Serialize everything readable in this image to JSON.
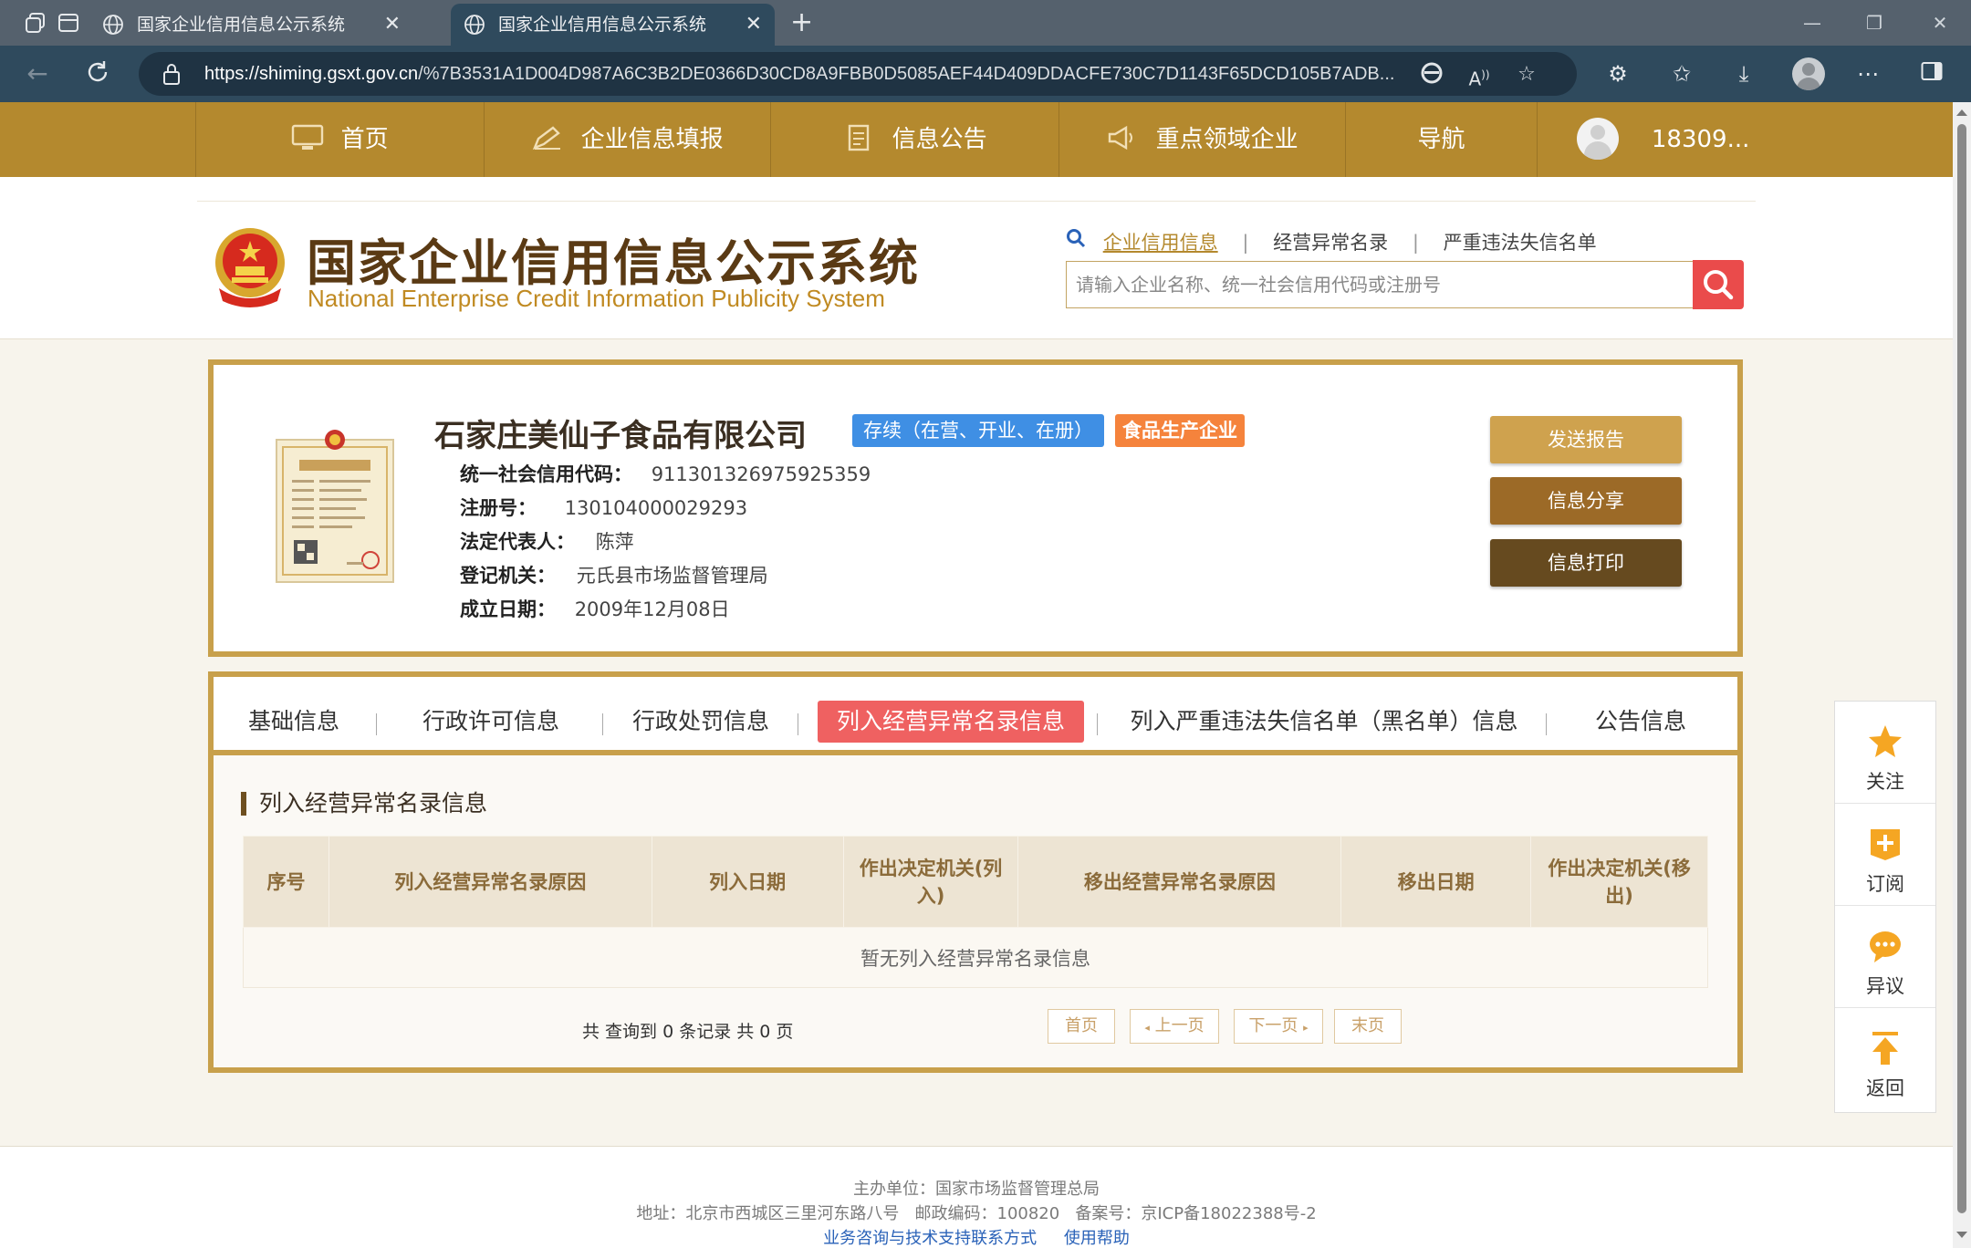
{
  "browser": {
    "tabs": [
      {
        "title": "国家企业信用信息公示系统",
        "active": false
      },
      {
        "title": "国家企业信用信息公示系统",
        "active": true
      }
    ],
    "url_domain": "https://shiming.gsxt.gov.cn",
    "url_path": "/%7B3531A1D004D987A6C3B2DE0366D30CD8A9FBB0D5085AEF44D409DDACFE730C7D1143F65DCD105B7ADB..."
  },
  "sitenav": {
    "items": [
      "首页",
      "企业信息填报",
      "信息公告",
      "重点领域企业",
      "导航"
    ],
    "user": "18309..."
  },
  "header": {
    "logo_cn": "国家企业信用信息公示系统",
    "logo_en": "National Enterprise Credit Information Publicity System",
    "search_links": [
      "企业信用信息",
      "经营异常名录",
      "严重违法失信名单"
    ],
    "search_placeholder": "请输入企业名称、统一社会信用代码或注册号"
  },
  "company": {
    "name": "石家庄美仙子食品有限公司",
    "status": "存续（在营、开业、在册）",
    "type_badge": "食品生产企业",
    "fields": [
      {
        "label": "统一社会信用代码：",
        "value": "911301326975925359"
      },
      {
        "label": "注册号：",
        "value": "130104000029293"
      },
      {
        "label": "法定代表人：",
        "value": "陈萍"
      },
      {
        "label": "登记机关：",
        "value": "元氏县市场监督管理局"
      },
      {
        "label": "成立日期：",
        "value": "2009年12月08日"
      }
    ],
    "actions": [
      "发送报告",
      "信息分享",
      "信息打印"
    ]
  },
  "panel": {
    "tabs": [
      "基础信息",
      "行政许可信息",
      "行政处罚信息",
      "列入经营异常名录信息",
      "列入严重违法失信名单（黑名单）信息",
      "公告信息"
    ],
    "active_tab": "列入经营异常名录信息",
    "section_title": "列入经营异常名录信息",
    "columns": [
      "序号",
      "列入经营异常名录原因",
      "列入日期",
      "作出决定机关(列入)",
      "移出经营异常名录原因",
      "移出日期",
      "作出决定机关(移出)"
    ],
    "empty_text": "暂无列入经营异常名录信息",
    "pager_summary": "共 查询到 0 条记录 共 0 页",
    "pager_buttons": [
      "首页",
      "上一页",
      "下一页",
      "末页"
    ]
  },
  "sidebar": {
    "items": [
      "关注",
      "订阅",
      "异议",
      "返回"
    ]
  },
  "footer": {
    "sponsor": "主办单位：国家市场监督管理总局",
    "address": "地址：北京市西城区三里河东路八号   邮政编码：100820   备案号：京ICP备18022388号-2",
    "links": [
      "业务咨询与技术支持联系方式",
      "使用帮助"
    ]
  },
  "colors": {
    "brand_gold": "#b4892e",
    "active_tab_red": "#ef6161",
    "status_blue": "#3f8fe4",
    "type_orange": "#f5833c",
    "search_red": "#ea4b4b"
  }
}
